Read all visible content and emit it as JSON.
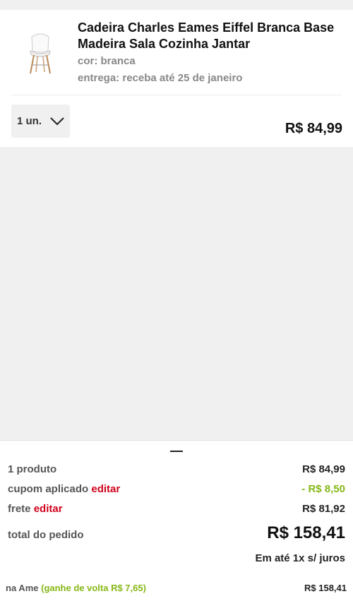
{
  "product": {
    "title": "Cadeira Charles Eames Eiffel Branca Base Madeira Sala Cozinha Jantar",
    "color_label": "cor:",
    "color_value": "branca",
    "delivery_label": "entrega:",
    "delivery_value": "receba até 25 de janeiro",
    "quantity": "1 un.",
    "price": "R$ 84,99",
    "thumbnail_icon": "white-chair-icon"
  },
  "summary": {
    "products_label": "1 produto",
    "products_amount": "R$ 84,99",
    "coupon_label": "cupom aplicado",
    "coupon_edit": "editar",
    "coupon_amount": "- R$ 8,50",
    "shipping_label": "frete",
    "shipping_edit": "editar",
    "shipping_amount": "R$ 81,92",
    "total_label": "total do pedido",
    "total_amount": "R$ 158,41",
    "installments": "Em até 1x s/ juros",
    "ame_label": "na Ame",
    "ame_cashback": "(ganhe de volta R$ 7,65)",
    "ame_amount": "R$ 158,41"
  },
  "colors": {
    "edit": "#d0021b",
    "discount": "#86b817",
    "background": "#f0f0f0"
  }
}
